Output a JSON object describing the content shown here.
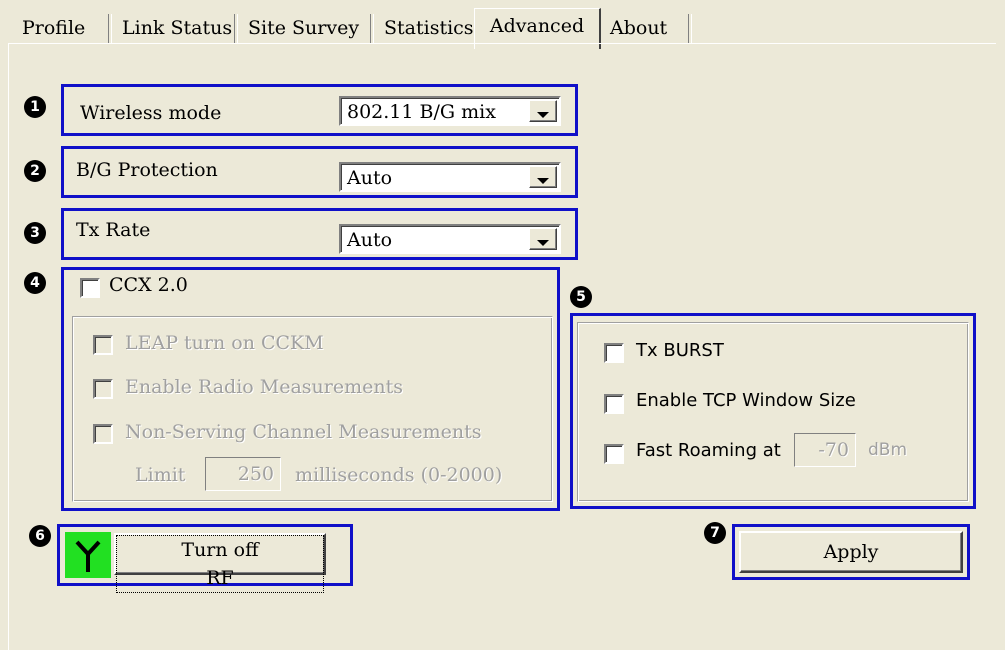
{
  "tabs": [
    "Profile",
    "Link Status",
    "Site Survey",
    "Statistics",
    "Advanced",
    "About"
  ],
  "active_tab": "Advanced",
  "badges": [
    "1",
    "2",
    "3",
    "4",
    "5",
    "6",
    "7"
  ],
  "wireless_mode": {
    "label": "Wireless mode",
    "value": "802.11 B/G mix"
  },
  "bg_protection": {
    "label": "B/G Protection",
    "value": "Auto"
  },
  "tx_rate": {
    "label": "Tx Rate",
    "value": "Auto"
  },
  "ccx": {
    "label": "CCX 2.0",
    "leap": "LEAP turn on CCKM",
    "radio_meas": "Enable Radio Measurements",
    "non_serving": "Non-Serving Channel Measurements",
    "limit_label": "Limit",
    "limit_value": "250",
    "limit_unit": "milliseconds (0-2000)"
  },
  "options": {
    "tx_burst": "Tx BURST",
    "tcp_window": "Enable TCP Window Size",
    "fast_roaming": "Fast Roaming at",
    "roaming_value": "-70",
    "roaming_unit": "dBm"
  },
  "rf": {
    "button": "Turn off RF",
    "indicator_color": "#22e022"
  },
  "apply": "Apply",
  "colors": {
    "highlight_box": "#1010c8",
    "background": "#ece9d8"
  }
}
